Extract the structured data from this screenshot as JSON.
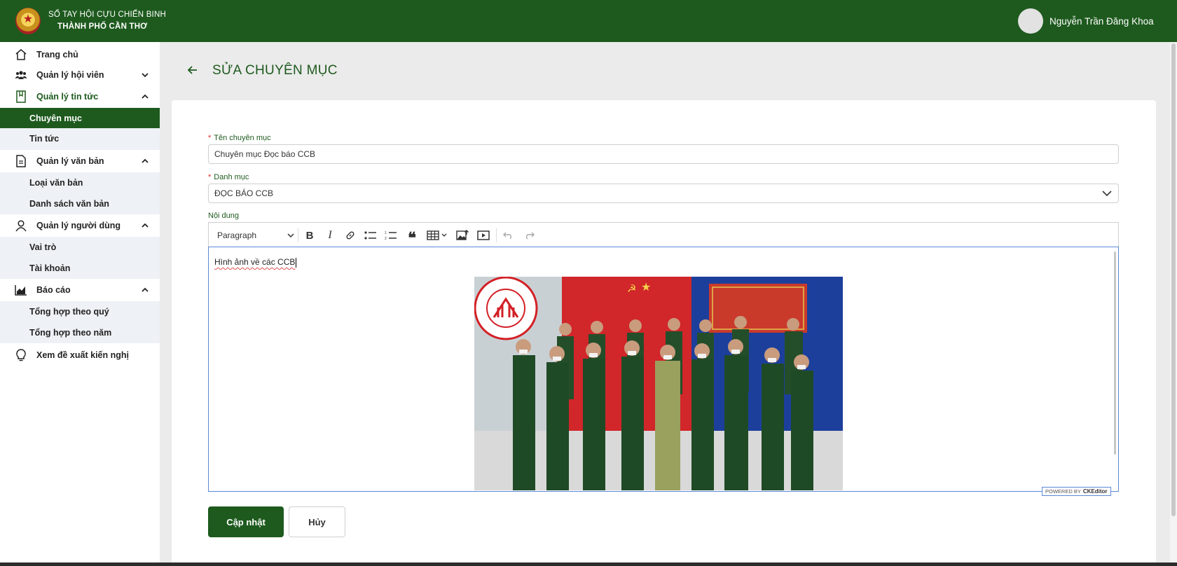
{
  "colors": {
    "primary": "#1e5a1e",
    "required": "#e02424",
    "editor_focus": "#5b8ad6"
  },
  "header": {
    "brand_line1": "SỔ TAY HỘI CỰU CHIẾN BINH",
    "brand_line2": "THÀNH PHỐ CẦN THƠ",
    "user_name": "Nguyễn Trần Đăng Khoa",
    "logo_icon": "emblem-icon"
  },
  "sidebar": {
    "home": "Trang chủ",
    "members": "Quản lý hội viên",
    "news": "Quản lý tin tức",
    "news_items": [
      "Chuyên mục",
      "Tin tức"
    ],
    "documents": "Quản lý văn bản",
    "documents_items": [
      "Loại văn bản",
      "Danh sách văn bản"
    ],
    "users": "Quản lý người dùng",
    "users_items": [
      "Vai trò",
      "Tài khoản"
    ],
    "reports": "Báo cáo",
    "reports_items": [
      "Tổng hợp theo quý",
      "Tổng hợp theo năm"
    ],
    "suggestions": "Xem đề xuất kiến nghị",
    "selected": "Chuyên mục"
  },
  "page": {
    "title": "SỬA CHUYÊN MỤC",
    "form": {
      "name_label": "Tên chuyên mục",
      "name_value": "Chuyên mục Đọc báo CCB",
      "category_label": "Danh mục",
      "category_value": "ĐỌC BÁO CCB",
      "content_label": "Nội dung",
      "required_mark": "*",
      "editor_heading_select": "Paragraph",
      "editor_text": "Hình ảnh về các CCB",
      "powered_by": "POWERED BY",
      "editor_brand": "CKEditor"
    },
    "buttons": {
      "update": "Cập nhật",
      "cancel": "Hủy"
    }
  }
}
